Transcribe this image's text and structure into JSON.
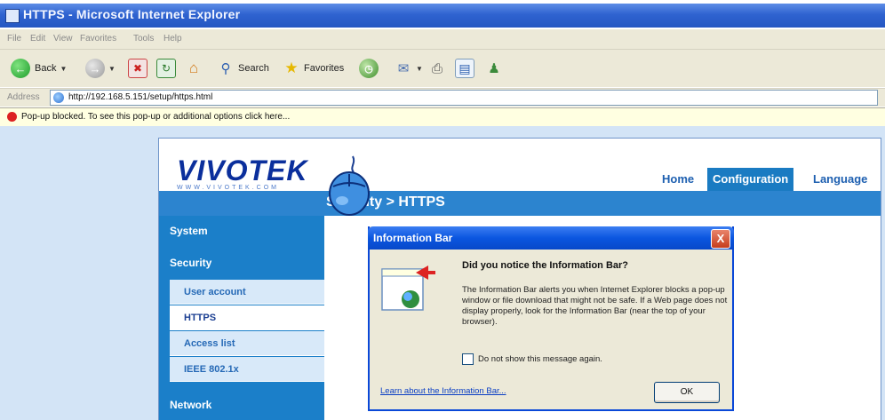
{
  "window": {
    "title": "HTTPS - Microsoft Internet Explorer"
  },
  "menu": [
    "File",
    "Edit",
    "View",
    "Favorites",
    "Tools",
    "Help"
  ],
  "toolbar": {
    "back_label": "Back",
    "search_label": "Search",
    "favorites_label": "Favorites"
  },
  "address": {
    "label": "Address",
    "url": "http://192.168.5.151/setup/https.html"
  },
  "infobar": {
    "text": "Pop-up blocked. To see this pop-up or additional options click here..."
  },
  "site": {
    "logo_main": "VIVOTEK",
    "logo_sub": "WWW.VIVOTEK.COM",
    "nav": {
      "home": "Home",
      "configuration": "Configuration",
      "language": "Language"
    },
    "breadcrumb": "Security > HTTPS",
    "sidebar": {
      "system": "System",
      "security": "Security",
      "sub": [
        "User account",
        "HTTPS",
        "Access list",
        "IEEE 802.1x"
      ],
      "network": "Network"
    }
  },
  "dialog": {
    "title": "Information Bar",
    "close": "X",
    "heading": "Did you notice the Information Bar?",
    "body": "The Information Bar alerts you when Internet Explorer blocks a pop-up window or file download that might not be safe. If a Web page does not display properly, look for the Information Bar (near the top of your browser).",
    "checkbox_label": "Do not show this message again.",
    "link": "Learn about the Information Bar...",
    "ok": "OK"
  },
  "colors": {
    "ie_titlebar": "#2f63d0",
    "site_blue": "#1b7fc9",
    "dialog_blue": "#0b56e0"
  }
}
